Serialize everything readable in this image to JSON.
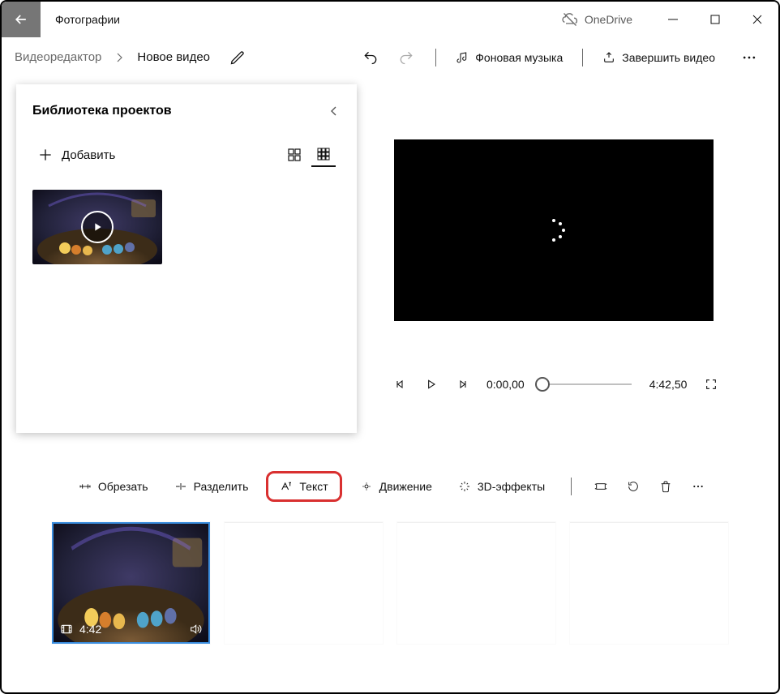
{
  "titlebar": {
    "app_title": "Фотографии",
    "cloud_label": "OneDrive"
  },
  "breadcrumb": {
    "root": "Видеоредактор",
    "current": "Новое видео"
  },
  "cmdbar": {
    "music": "Фоновая музыка",
    "finish": "Завершить видео"
  },
  "library": {
    "title": "Библиотека проектов",
    "add": "Добавить"
  },
  "playback": {
    "time_current": "0:00,00",
    "time_total": "4:42,50"
  },
  "editbar": {
    "trim": "Обрезать",
    "split": "Разделить",
    "text": "Текст",
    "motion": "Движение",
    "fx3d": "3D-эффекты"
  },
  "storyboard": {
    "clip_duration": "4:42"
  }
}
